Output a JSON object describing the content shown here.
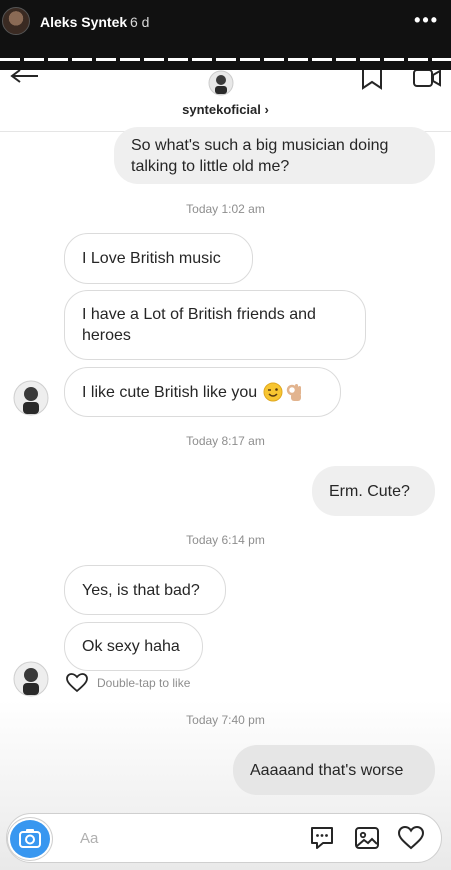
{
  "story": {
    "user_name": "Aleks Syntek",
    "age": "6 d",
    "more_glyph": "•••"
  },
  "header": {
    "username": "syntekoficial",
    "chevron": "›"
  },
  "messages": [
    {
      "side": "outgoing",
      "text": "So what's such a big musician doing talking to little old me?"
    },
    {
      "side": "time",
      "text": "Today 1:02 am"
    },
    {
      "side": "incoming",
      "text": "I Love British music"
    },
    {
      "side": "incoming",
      "text": "I have  a Lot of British friends and heroes"
    },
    {
      "side": "incoming",
      "text": "I like cute British like you",
      "emojis": [
        "winking-face-emoji",
        "ok-hand-emoji"
      ]
    },
    {
      "side": "time",
      "text": "Today 8:17 am"
    },
    {
      "side": "outgoing",
      "text": "Erm.  Cute?"
    },
    {
      "side": "time",
      "text": "Today 6:14 pm"
    },
    {
      "side": "incoming",
      "text": "Yes, is that bad?"
    },
    {
      "side": "incoming",
      "text": "Ok sexy haha"
    },
    {
      "side": "time",
      "text": "Today 7:40 pm"
    },
    {
      "side": "outgoing",
      "text": "Aaaaand that's worse"
    }
  ],
  "like_hint": "Double-tap to like",
  "composer": {
    "placeholder": "Aa",
    "icons": [
      "camera-icon",
      "chat-bubble-icon",
      "gallery-icon",
      "heart-icon"
    ]
  },
  "colors": {
    "accent": "#3897f0",
    "incoming_bg": "#ffffff",
    "outgoing_bg": "#efefef",
    "meta_text": "#8e8e8e"
  }
}
